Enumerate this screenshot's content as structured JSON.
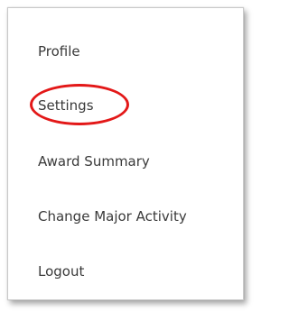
{
  "menu": {
    "items": [
      {
        "label": "Profile"
      },
      {
        "label": "Settings",
        "highlighted": true
      },
      {
        "label": "Award Summary"
      },
      {
        "label": "Change Major Activity"
      },
      {
        "label": "Logout"
      }
    ]
  },
  "colors": {
    "text": "#3a3a3a",
    "highlight_ring": "#e31818",
    "background": "#ffffff"
  }
}
